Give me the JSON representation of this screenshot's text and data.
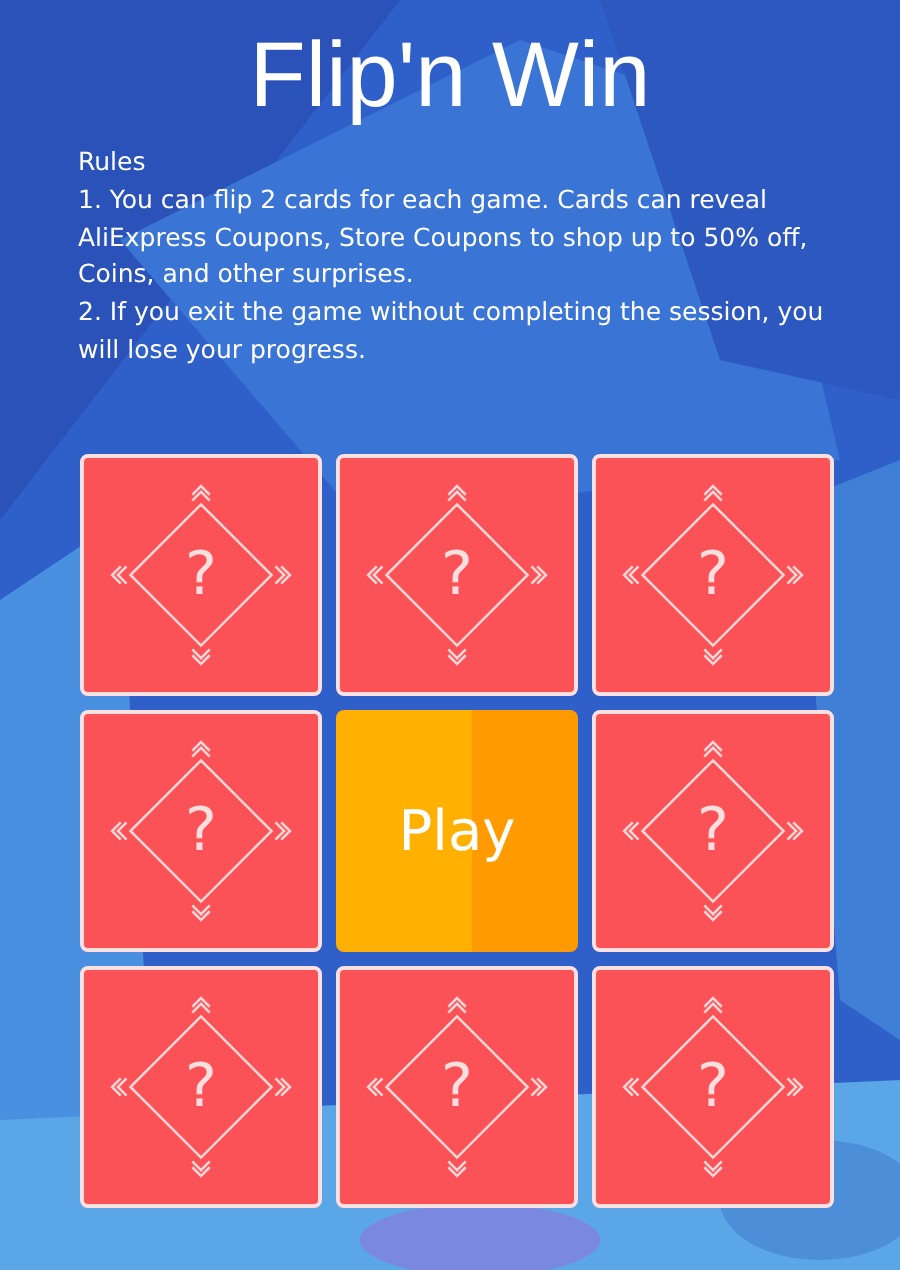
{
  "title": "Flip'n Win",
  "rules": {
    "heading": "Rules",
    "items": [
      "1. You can flip 2 cards for each game. Cards can reveal AliExpress Coupons, Store Coupons to shop up to 50% off, Coins, and other surprises.",
      "2. If you exit the game without completing the session, you will lose your progress."
    ]
  },
  "cards": [
    {
      "kind": "hidden",
      "label": "?"
    },
    {
      "kind": "hidden",
      "label": "?"
    },
    {
      "kind": "hidden",
      "label": "?"
    },
    {
      "kind": "hidden",
      "label": "?"
    },
    {
      "kind": "play",
      "label": "Play"
    },
    {
      "kind": "hidden",
      "label": "?"
    },
    {
      "kind": "hidden",
      "label": "?"
    },
    {
      "kind": "hidden",
      "label": "?"
    },
    {
      "kind": "hidden",
      "label": "?"
    }
  ]
}
